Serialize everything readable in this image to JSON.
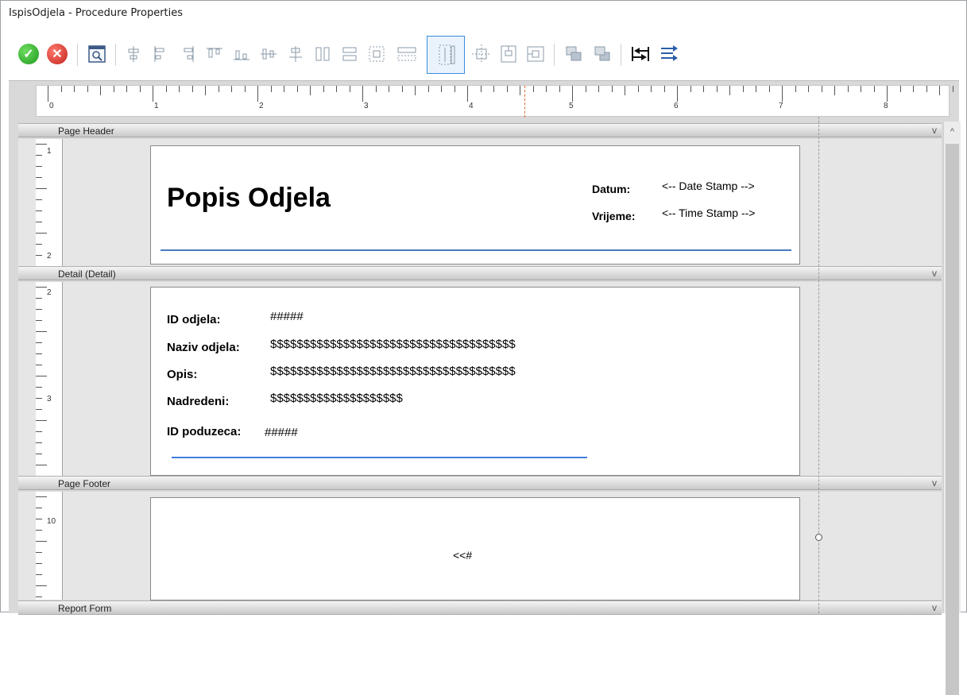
{
  "window": {
    "title": "IspisOdjela - Procedure Properties"
  },
  "toolbar": {
    "icons": [
      "ok-icon",
      "cancel-icon",
      "preview-icon",
      "align-center-icon",
      "align-left-icon",
      "align-right-icon",
      "align-top-icon",
      "align-bottom-icon",
      "align-middle-icon",
      "center-horizontally-icon",
      "make-same-width-icon",
      "make-same-height-icon",
      "size-to-grid-icon",
      "space-horizontal-icon",
      "space-vertical-icon",
      "center-in-band-icon",
      "center-vertical-icon",
      "center-horizontal-icon",
      "bring-to-front-icon",
      "send-to-back-icon",
      "tab-order-icon",
      "wrap-icon"
    ],
    "ok_symbol": "✓",
    "cancel_symbol": "✕"
  },
  "ruler": {
    "labels": [
      "0",
      "1",
      "2",
      "3",
      "4",
      "5",
      "6",
      "7",
      "8"
    ]
  },
  "bands": {
    "page_header": "Page Header",
    "detail": "Detail (Detail)",
    "page_footer": "Page Footer",
    "report_form": "Report Form"
  },
  "vruler": {
    "header_labels": [
      "1",
      "2"
    ],
    "detail_labels": [
      "2",
      "3"
    ],
    "footer_labels": [
      "10"
    ]
  },
  "header": {
    "title": "Popis Odjela",
    "date_label": "Datum:",
    "date_value": "<-- Date Stamp -->",
    "time_label": "Vrijeme:",
    "time_value": "<-- Time Stamp -->"
  },
  "detail": {
    "fields": [
      {
        "label": "ID odjela:",
        "value": "#####"
      },
      {
        "label": "Naziv odjela:",
        "value": "$$$$$$$$$$$$$$$$$$$$$$$$$$$$$$$$$$$$$"
      },
      {
        "label": "Opis:",
        "value": "$$$$$$$$$$$$$$$$$$$$$$$$$$$$$$$$$$$$$"
      },
      {
        "label": "Nadredeni:",
        "value": "$$$$$$$$$$$$$$$$$$$$"
      },
      {
        "label": "ID poduzeca:",
        "value": "#####"
      }
    ]
  },
  "footer": {
    "page_number": "<<#"
  },
  "scroll": {
    "up_arrow": "^",
    "chevron": "v"
  }
}
